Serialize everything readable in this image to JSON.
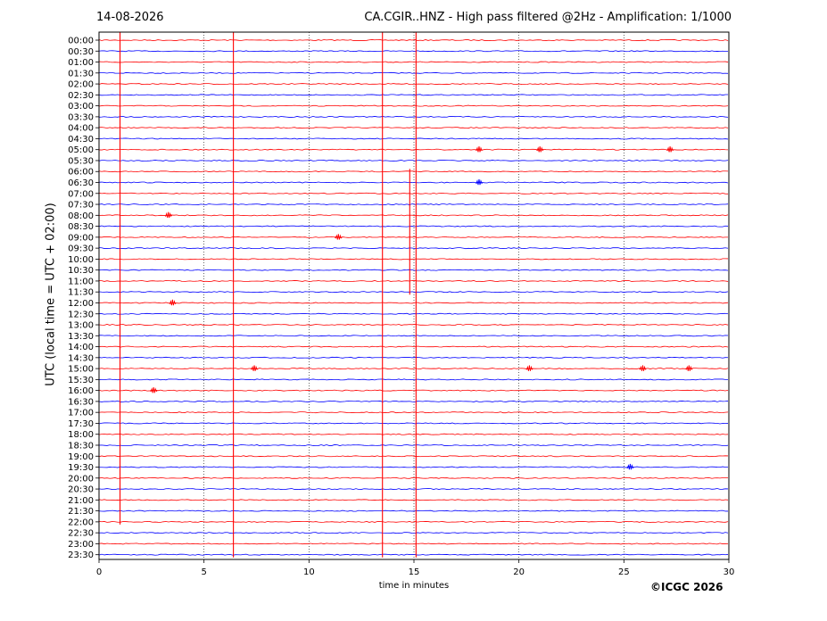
{
  "header": {
    "date": "14-08-2026",
    "station_title": "CA.CGIR..HNZ - High pass filtered @2Hz - Amplification: 1/1000"
  },
  "footer": {
    "copyright": "©ICGC 2026"
  },
  "chart_data": {
    "type": "line",
    "title": "CA.CGIR..HNZ - High pass filtered @2Hz - Amplification: 1/1000",
    "xlabel": "time in minutes",
    "ylabel": "UTC (local time = UTC + 02:00)",
    "xlim": [
      0,
      30
    ],
    "x_ticks": [
      0,
      5,
      10,
      15,
      20,
      25,
      30
    ],
    "rows": [
      "00:00",
      "00:30",
      "01:00",
      "01:30",
      "02:00",
      "02:30",
      "03:00",
      "03:30",
      "04:00",
      "04:30",
      "05:00",
      "05:30",
      "06:00",
      "06:30",
      "07:00",
      "07:30",
      "08:00",
      "08:30",
      "09:00",
      "09:30",
      "10:00",
      "10:30",
      "11:00",
      "11:30",
      "12:00",
      "12:30",
      "13:00",
      "13:30",
      "14:00",
      "14:30",
      "15:00",
      "15:30",
      "16:00",
      "16:30",
      "17:00",
      "17:30",
      "18:00",
      "18:30",
      "19:00",
      "19:30",
      "20:00",
      "20:30",
      "21:00",
      "21:30",
      "22:00",
      "22:30",
      "23:00",
      "23:30"
    ],
    "row_colors": [
      "#ff0000",
      "#0000ff"
    ],
    "grid": "vertical dotted",
    "spikes": [
      {
        "minute": 1.0,
        "from_row": "00:00",
        "to_row": "22:00"
      },
      {
        "minute": 6.4,
        "from_row": "00:00",
        "to_row": "23:30"
      },
      {
        "minute": 13.5,
        "from_row": "00:00",
        "to_row": "23:30"
      },
      {
        "minute": 15.1,
        "from_row": "00:00",
        "to_row": "23:30"
      },
      {
        "minute": 14.8,
        "from_row": "06:00",
        "to_row": "11:30"
      }
    ],
    "events": [
      {
        "row": "05:00",
        "minute": 18.1
      },
      {
        "row": "05:00",
        "minute": 21.0
      },
      {
        "row": "05:00",
        "minute": 27.2
      },
      {
        "row": "06:30",
        "minute": 18.1
      },
      {
        "row": "08:00",
        "minute": 3.3
      },
      {
        "row": "09:00",
        "minute": 11.4
      },
      {
        "row": "12:00",
        "minute": 3.5
      },
      {
        "row": "15:00",
        "minute": 7.4
      },
      {
        "row": "15:00",
        "minute": 20.5
      },
      {
        "row": "15:00",
        "minute": 25.9
      },
      {
        "row": "15:00",
        "minute": 28.1
      },
      {
        "row": "16:00",
        "minute": 2.6
      },
      {
        "row": "19:30",
        "minute": 25.3
      }
    ]
  }
}
